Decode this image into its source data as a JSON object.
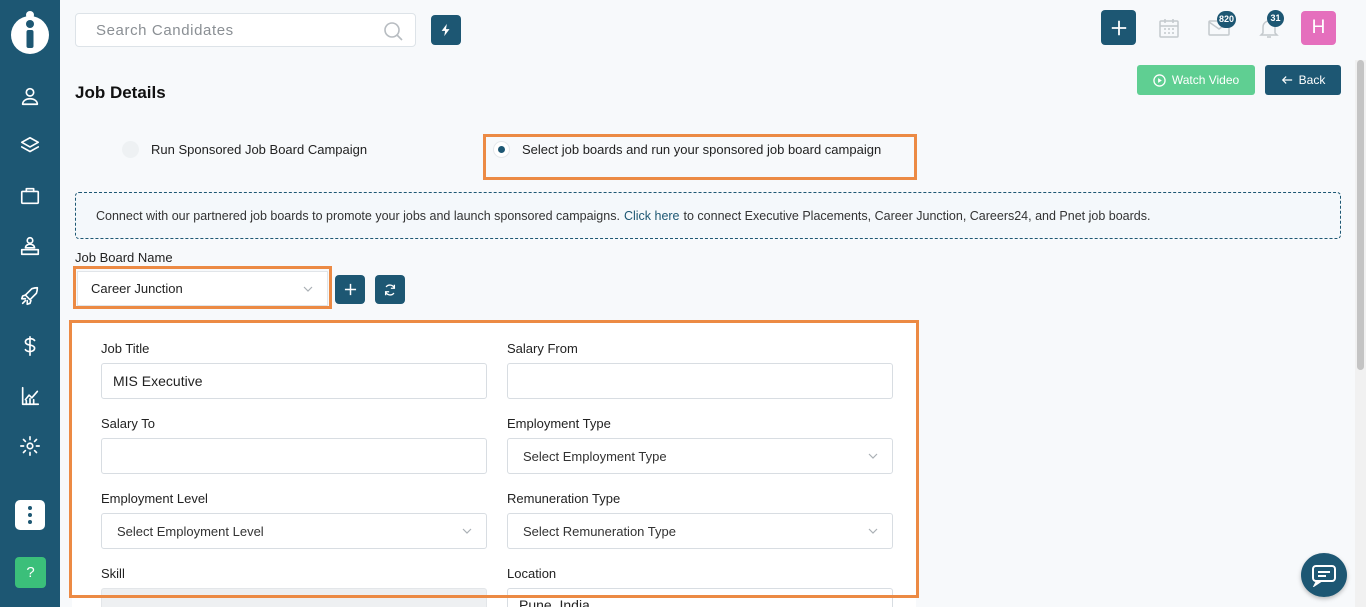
{
  "colors": {
    "primary": "#1d5773",
    "success": "#5fcf92",
    "highlight": "#ec8a44",
    "avatar": "#e56fbd",
    "help": "#3bbf7a"
  },
  "search": {
    "placeholder": "Search Candidates"
  },
  "topbar": {
    "mail_count": "820",
    "notification_count": "31",
    "avatar_initial": "H"
  },
  "sidebar": {
    "icons": [
      "user-icon",
      "layers-icon",
      "briefcase-icon",
      "team-icon",
      "rocket-icon",
      "dollar-icon",
      "analytics-icon",
      "settings-icon"
    ],
    "help_label": "?"
  },
  "header": {
    "title": "Job Details",
    "watch_video": "Watch Video",
    "back": "Back"
  },
  "campaign_options": [
    {
      "label": "Run Sponsored Job Board Campaign",
      "selected": false
    },
    {
      "label": "Select job boards and run your sponsored job board campaign",
      "selected": true
    }
  ],
  "info": {
    "text_before": "Connect with our partnered job boards to promote your jobs and launch sponsored campaigns.",
    "link": "Click here",
    "text_after": "to connect Executive Placements, Career Junction, Careers24, and Pnet job boards."
  },
  "job_board": {
    "label": "Job Board Name",
    "value": "Career Junction"
  },
  "form": {
    "job_title": {
      "label": "Job Title",
      "value": "MIS Executive"
    },
    "salary_from": {
      "label": "Salary From",
      "value": ""
    },
    "salary_to": {
      "label": "Salary To",
      "value": ""
    },
    "employment_type": {
      "label": "Employment Type",
      "value": "Select Employment Type"
    },
    "employment_level": {
      "label": "Employment Level",
      "value": "Select Employment Level"
    },
    "remuneration_type": {
      "label": "Remuneration Type",
      "value": "Select Remuneration Type"
    },
    "skill": {
      "label": "Skill",
      "value": ""
    },
    "location": {
      "label": "Location",
      "value": "Pune, India"
    }
  }
}
